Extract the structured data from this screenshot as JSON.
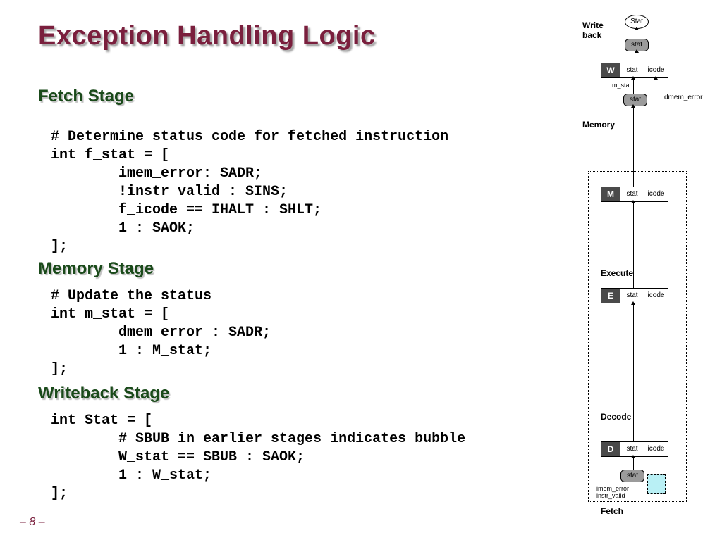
{
  "title": "Exception Handling Logic",
  "page_number": "– 8 –",
  "sections": {
    "fetch": {
      "heading": "Fetch Stage",
      "code": "# Determine status code for fetched instruction\nint f_stat = [\n        imem_error: SADR;\n        !instr_valid : SINS;\n        f_icode == IHALT : SHLT;\n        1 : SAOK;\n];"
    },
    "memory": {
      "heading": "Memory Stage",
      "code": "# Update the status\nint m_stat = [\n        dmem_error : SADR;\n        1 : M_stat;\n];"
    },
    "writeback": {
      "heading": "Writeback Stage",
      "code": "int Stat = [\n        # SBUB in earlier stages indicates bubble\n        W_stat == SBUB : SAOK;\n        1 : W_stat;\n];"
    }
  },
  "diagram": {
    "top_label": "Write\nback",
    "stat_oval": "Stat",
    "stat_small": "stat",
    "m_stat_label": "m_stat",
    "dmem_error_label": "dmem_error",
    "memory_label": "Memory",
    "execute_label": "Execute",
    "decode_label": "Decode",
    "fetch_label": "Fetch",
    "imem_lines": "imem_error\ninstr_valid",
    "stages": {
      "W": {
        "tag": "W",
        "c1": "stat",
        "c2": "icode"
      },
      "M": {
        "tag": "M",
        "c1": "stat",
        "c2": "icode"
      },
      "E": {
        "tag": "E",
        "c1": "stat",
        "c2": "icode"
      },
      "D": {
        "tag": "D",
        "c1": "stat",
        "c2": "icode"
      }
    }
  }
}
